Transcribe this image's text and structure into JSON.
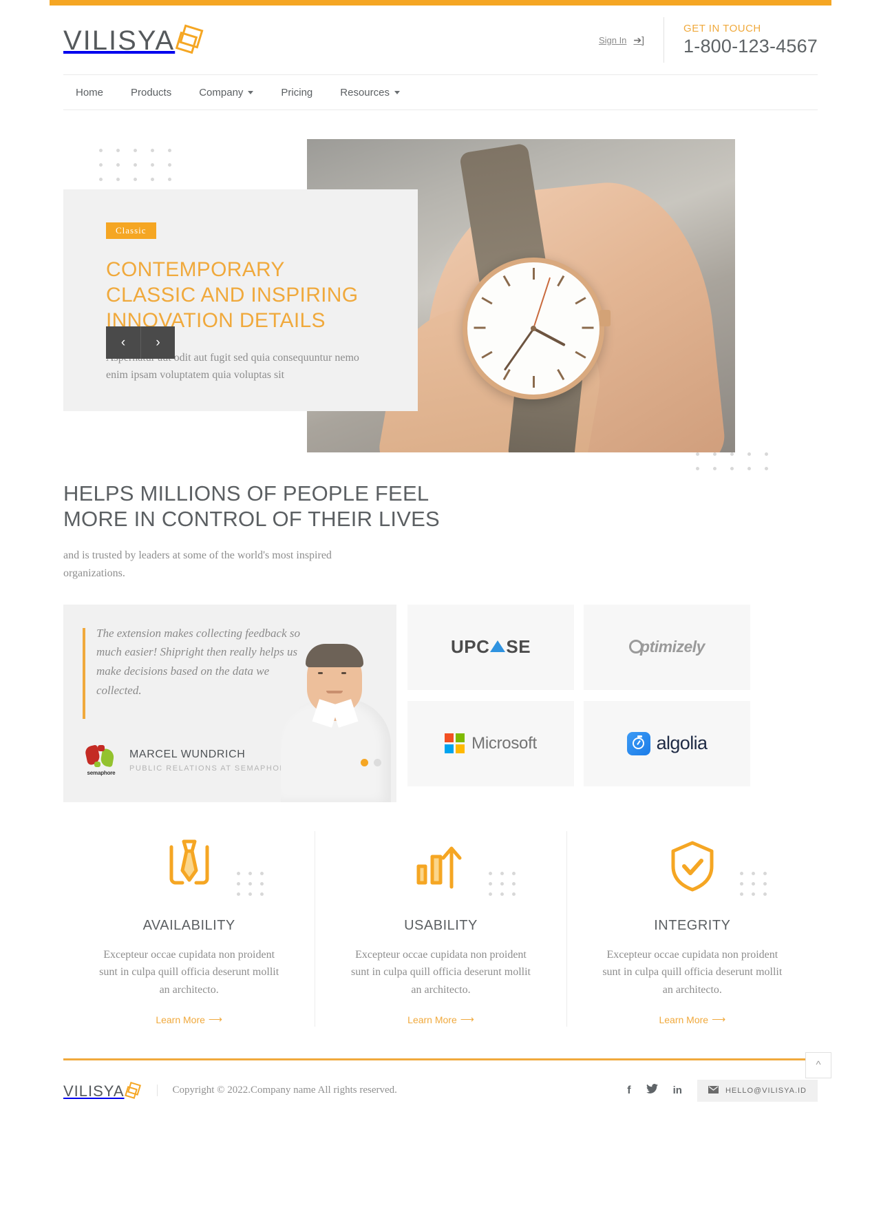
{
  "brand": {
    "name": "VILISYA",
    "mark_icon": "overlapping-squares-icon"
  },
  "header": {
    "sign_in": "Sign In",
    "sign_in_icon": "sign-in-icon",
    "get_in_touch_label": "GET IN TOUCH",
    "phone": "1-800-123-4567"
  },
  "nav": {
    "items": [
      {
        "label": "Home",
        "has_caret": false
      },
      {
        "label": "Products",
        "has_caret": false
      },
      {
        "label": "Company",
        "has_caret": true
      },
      {
        "label": "Pricing",
        "has_caret": false
      },
      {
        "label": "Resources",
        "has_caret": true
      }
    ]
  },
  "hero": {
    "badge": "Classic",
    "title_lines": [
      "CONTEMPORARY",
      "CLASSIC AND INSPIRING",
      "INNOVATION DETAILS"
    ],
    "subtitle": "Aspernatur aut odit aut fugit sed quia consequuntur nemo enim ipsam voluptatem quia voluptas sit",
    "prev_label": "‹",
    "next_label": "›",
    "image_alt": "hand-holding-wristwatch-photo"
  },
  "trusted": {
    "heading_lines": [
      "HELPS MILLIONS OF PEOPLE FEEL",
      "MORE IN CONTROL OF THEIR LIVES"
    ],
    "subtitle": "and is trusted by leaders at some of the world's most inspired organizations."
  },
  "testimonial": {
    "quote": "The extension makes collecting feedback so much easier! Shipright then really helps us make decisions based on the data we collected.",
    "author_name": "MARCEL WUNDRICH",
    "author_role": "PUBLIC RELATIONS AT SEMAPHORE",
    "company_logo": "semaphore-logo",
    "company_word": "semaphore",
    "slides": [
      {
        "active": true
      },
      {
        "active": false
      }
    ]
  },
  "logos": [
    {
      "name": "UPCASE",
      "icon": "upcase-logo"
    },
    {
      "name": "Optimizely",
      "icon": "optimizely-logo"
    },
    {
      "name": "Microsoft",
      "icon": "microsoft-logo"
    },
    {
      "name": "algolia",
      "icon": "algolia-logo"
    }
  ],
  "features": [
    {
      "icon": "tie-icon",
      "title": "AVAILABILITY",
      "text": "Excepteur occae cupidata non proident sunt in culpa quill officia deserunt mollit an architecto.",
      "link": "Learn More"
    },
    {
      "icon": "growth-chart-icon",
      "title": "USABILITY",
      "text": "Excepteur occae cupidata non proident sunt in culpa quill officia deserunt mollit an architecto.",
      "link": "Learn More"
    },
    {
      "icon": "shield-check-icon",
      "title": "INTEGRITY",
      "text": "Excepteur occae cupidata non proident sunt in culpa quill officia deserunt mollit an architecto.",
      "link": "Learn More"
    }
  ],
  "footer": {
    "copyright": "Copyright © 2022.Company name All rights reserved.",
    "social": [
      {
        "label": "f",
        "icon": "facebook-icon"
      },
      {
        "label": "✈",
        "icon": "twitter-icon"
      },
      {
        "label": "in",
        "icon": "linkedin-icon"
      }
    ],
    "email": "HELLO@VILISYA.ID",
    "email_icon": "envelope-icon",
    "to_top_icon": "chevron-up-icon"
  },
  "colors": {
    "accent": "#f5a623",
    "accent_soft": "#f0a93c",
    "text": "#5b5f62",
    "muted": "#8d8d8d"
  }
}
